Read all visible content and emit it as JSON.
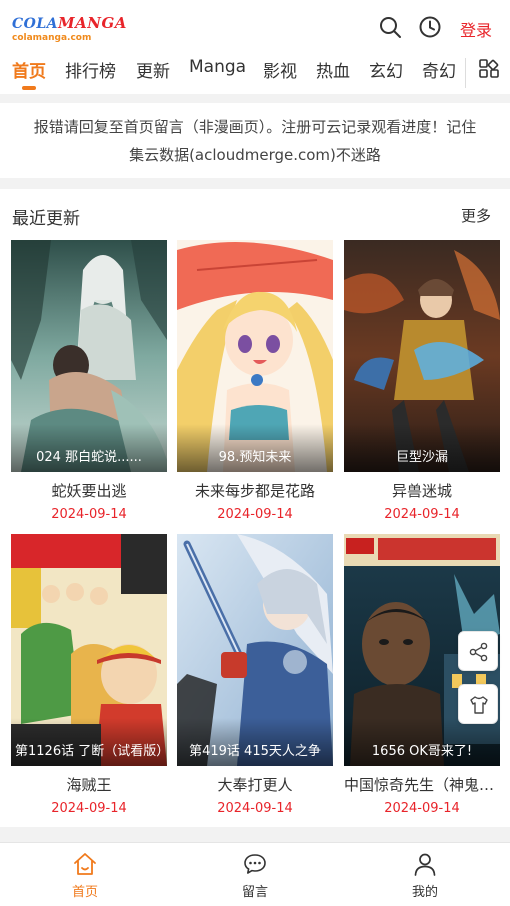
{
  "header": {
    "logo_line1_a": "COLA",
    "logo_line1_b": "MANGA",
    "logo_line2": "colamanga.com",
    "login": "登录",
    "icons": [
      "search-icon",
      "history-clock-icon"
    ]
  },
  "tabs": [
    {
      "label": "首页",
      "active": true
    },
    {
      "label": "排行榜"
    },
    {
      "label": "更新"
    },
    {
      "label": "Manga"
    },
    {
      "label": "影视"
    },
    {
      "label": "热血"
    },
    {
      "label": "玄幻"
    },
    {
      "label": "奇幻"
    }
  ],
  "notice": {
    "line1": "报错请回复至首页留言（非漫画页）。注册可云记录观看进度！记住",
    "line2": "集云数据(acloudmerge.com)不迷路"
  },
  "recent": {
    "title": "最近更新",
    "more": "更多",
    "items": [
      {
        "episode": "024 那白蛇说......",
        "title": "蛇妖要出逃",
        "date": "2024-09-14"
      },
      {
        "episode": "98.预知未来",
        "title": "未来每步都是花路",
        "date": "2024-09-14"
      },
      {
        "episode": "巨型沙漏",
        "title": "异兽迷城",
        "date": "2024-09-14"
      },
      {
        "episode": "第1126话 了断（试看版）",
        "title": "海贼王",
        "date": "2024-09-14"
      },
      {
        "episode": "第419话 415天人之争",
        "title": "大奉打更人",
        "date": "2024-09-14"
      },
      {
        "episode": "1656 OK哥来了!",
        "title": "中国惊奇先生（神鬼七杀令）",
        "date": "2024-09-14"
      }
    ]
  },
  "float_buttons": [
    "share-icon",
    "tshirt-icon"
  ],
  "bottom_nav": [
    {
      "label": "首页",
      "icon": "home-icon",
      "active": true
    },
    {
      "label": "留言",
      "icon": "chat-icon"
    },
    {
      "label": "我的",
      "icon": "user-icon"
    }
  ],
  "colors": {
    "accent": "#f07a1c",
    "red": "#e8242a"
  }
}
